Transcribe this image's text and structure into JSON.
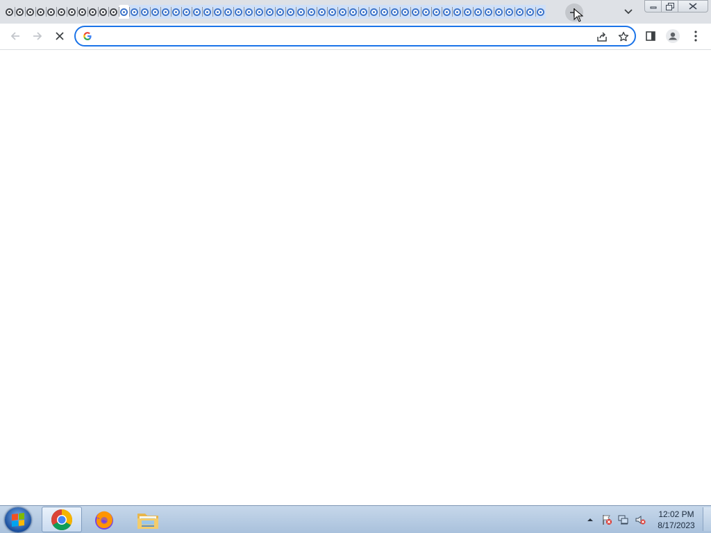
{
  "browser": {
    "tabs": {
      "dark_count": 11,
      "blue_count": 41,
      "active_index": 11
    },
    "omnibox": {
      "value": "",
      "placeholder": ""
    },
    "colors": {
      "tabstrip": "#dee1e6",
      "omnibox_border": "#1a73e8"
    }
  },
  "taskbar": {
    "apps": [
      "chrome-icon",
      "firefox-icon",
      "file-explorer-icon"
    ],
    "clock": {
      "time": "12:02 PM",
      "date": "8/17/2023"
    }
  }
}
